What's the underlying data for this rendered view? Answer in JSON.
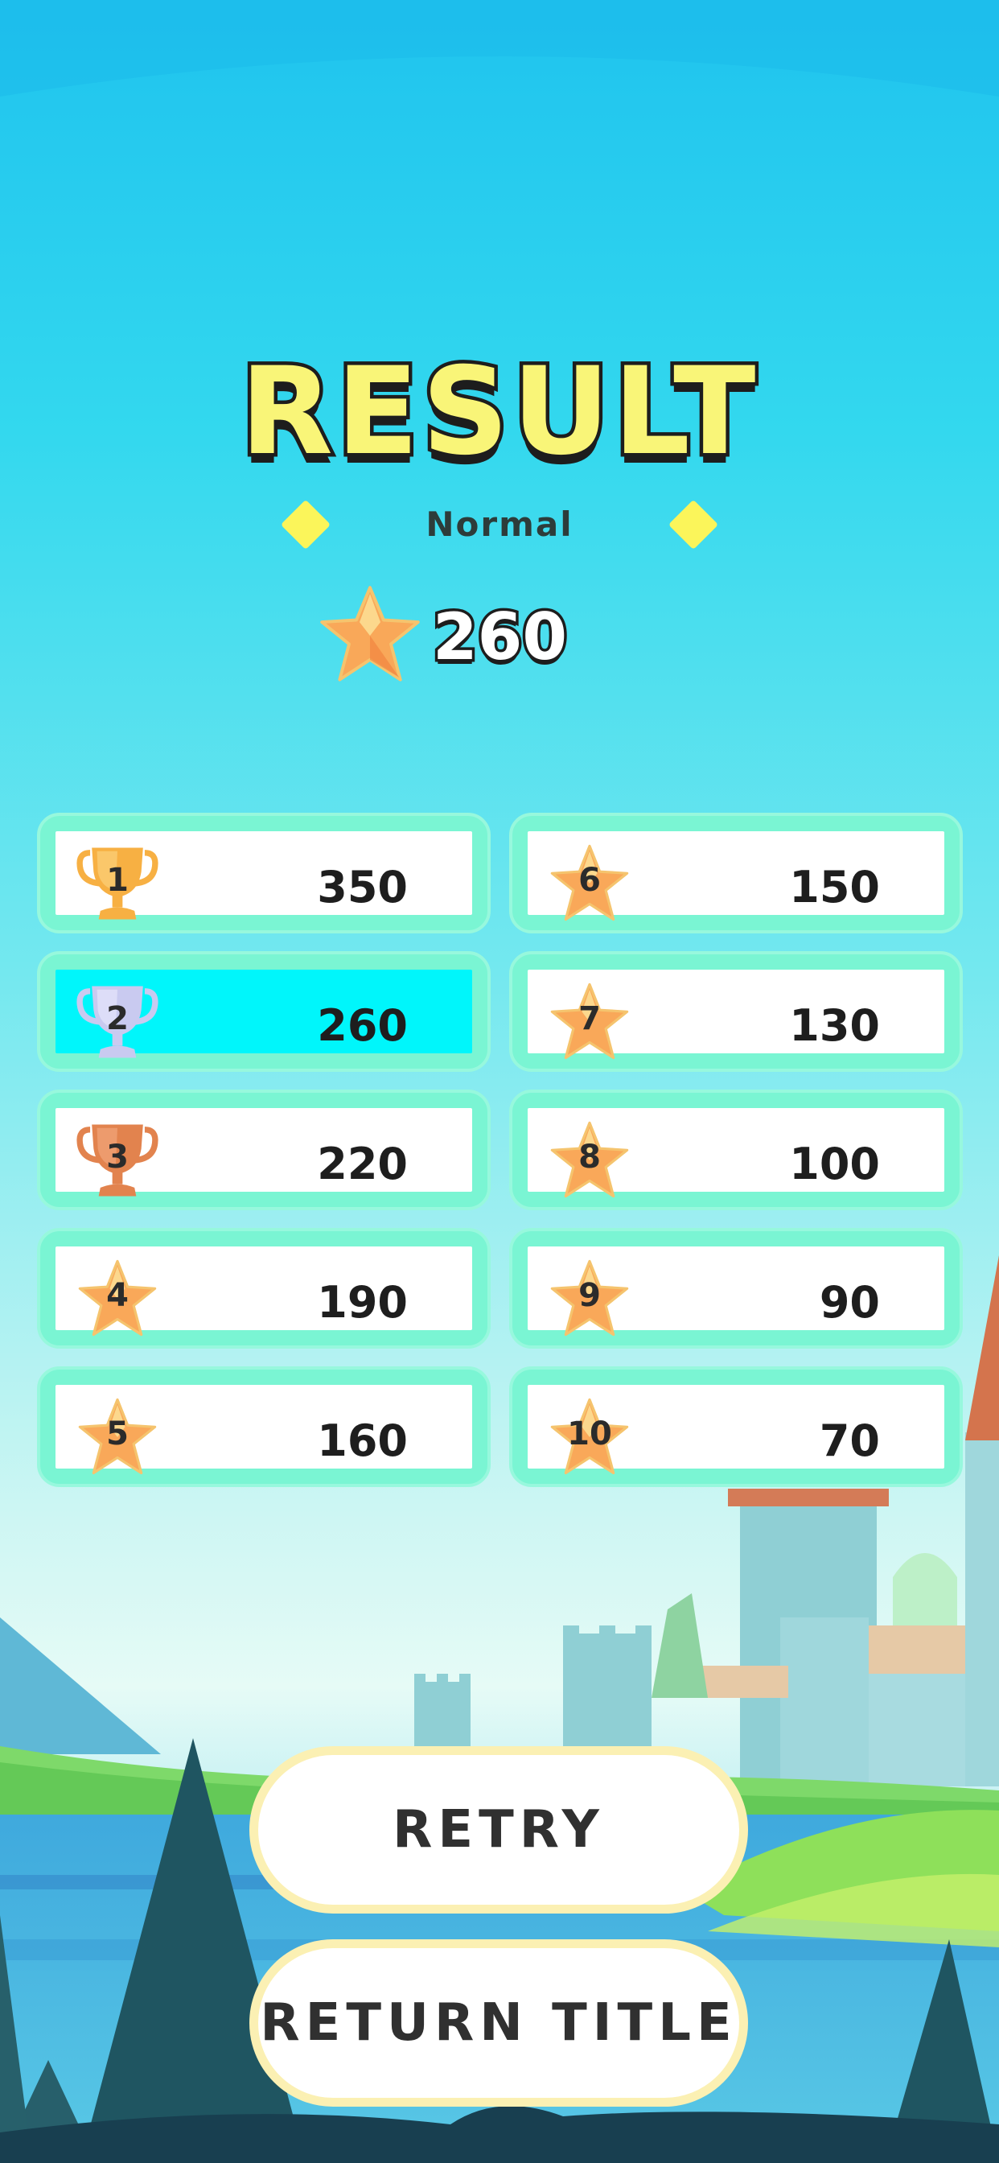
{
  "result": {
    "title": "RESULT",
    "difficulty": "Normal",
    "score": "260"
  },
  "ranking": [
    {
      "rank": "1",
      "score": "350",
      "badge": "gold-trophy-icon"
    },
    {
      "rank": "2",
      "score": "260",
      "badge": "silver-trophy-icon",
      "highlight": true
    },
    {
      "rank": "3",
      "score": "220",
      "badge": "bronze-trophy-icon"
    },
    {
      "rank": "4",
      "score": "190",
      "badge": "star-icon"
    },
    {
      "rank": "5",
      "score": "160",
      "badge": "star-icon"
    },
    {
      "rank": "6",
      "score": "150",
      "badge": "star-icon"
    },
    {
      "rank": "7",
      "score": "130",
      "badge": "star-icon"
    },
    {
      "rank": "8",
      "score": "100",
      "badge": "star-icon"
    },
    {
      "rank": "9",
      "score": "90",
      "badge": "star-icon"
    },
    {
      "rank": "10",
      "score": "70",
      "badge": "star-icon"
    }
  ],
  "buttons": {
    "retry": "RETRY",
    "return_title": "RETURN TITLE"
  },
  "colors": {
    "title_fill": "#f9f578",
    "card_frame": "#7af5d3",
    "highlight_row": "#00f6fb",
    "button_border": "#fbf0b3",
    "gold": "#f7b043",
    "silver": "#c9caf0",
    "bronze": "#e2834e"
  }
}
